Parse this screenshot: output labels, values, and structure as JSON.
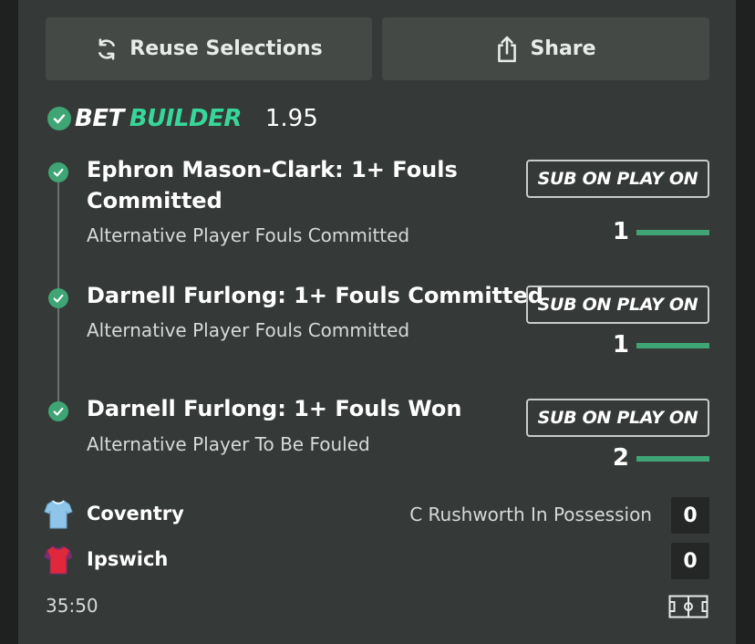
{
  "actions": {
    "reuse_label": "Reuse Selections",
    "share_label": "Share"
  },
  "bet_builder": {
    "title_bet": "BET",
    "title_builder": "BUILDER",
    "odds": "1.95"
  },
  "selections": [
    {
      "title_line1": "Ephron Mason-Clark: 1+ Fouls",
      "title_line2": "Committed",
      "market": "Alternative Player Fouls Committed",
      "badge": "SUB ON PLAY ON",
      "progress": 1,
      "progress_display": "1"
    },
    {
      "title_line1": "Darnell Furlong: 1+ Fouls Committed",
      "market": "Alternative Player Fouls Committed",
      "badge": "SUB ON PLAY ON",
      "progress": 1,
      "progress_display": "1"
    },
    {
      "title_line1": "Darnell Furlong: 1+ Fouls Won",
      "market": "Alternative Player To Be Fouled",
      "badge": "SUB ON PLAY ON",
      "progress": 1,
      "progress_display": "2"
    }
  ],
  "match": {
    "home": {
      "name": "Coventry",
      "score": "0",
      "shirt_color": "#8ec5e8"
    },
    "away": {
      "name": "Ipswich",
      "score": "0",
      "shirt_color": "#e0283a"
    },
    "possession_text": "C Rushworth In Possession",
    "clock": "35:50"
  },
  "colors": {
    "accent_green": "#37d69a",
    "check_green": "#3fa574",
    "card_bg": "#353937"
  },
  "icons": [
    "refresh-icon",
    "share-icon",
    "check-circle-icon",
    "shirt-icon",
    "pitch-icon"
  ]
}
